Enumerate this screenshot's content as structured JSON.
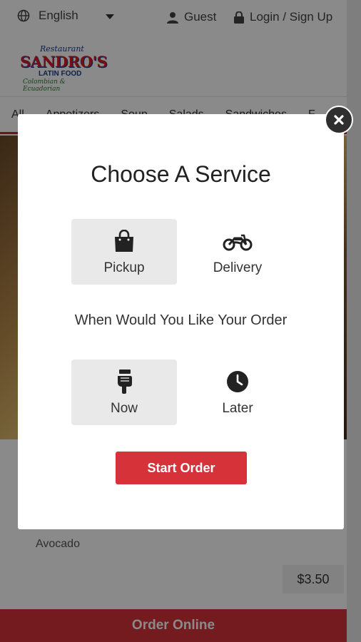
{
  "topbar": {
    "language": "English",
    "guest": "Guest",
    "login": "Login / Sign Up"
  },
  "logo": {
    "script": "Restaurant",
    "main": "SANDRO'S",
    "sub": "LATIN FOOD",
    "tag": "Colombian & Ecuadorian"
  },
  "categories": [
    "All",
    "Appetizers",
    "Soup",
    "Salads",
    "Sandwiches",
    "F"
  ],
  "menu_item": {
    "description": "Avocado",
    "price": "$3.50"
  },
  "order_bar": {
    "label": "Order Online"
  },
  "modal": {
    "title": "Choose A Service",
    "service_options": [
      {
        "label": "Pickup",
        "icon": "shopping-bag-icon",
        "selected": true
      },
      {
        "label": "Delivery",
        "icon": "motorcycle-icon",
        "selected": false
      }
    ],
    "when_prompt": "When Would You Like Your Order",
    "time_options": [
      {
        "label": "Now",
        "icon": "pointing-hand-icon",
        "selected": true
      },
      {
        "label": "Later",
        "icon": "clock-icon",
        "selected": false
      }
    ],
    "start_button": "Start Order"
  },
  "colors": {
    "accent_red": "#d6323a",
    "selected_bg": "#e9e9e9",
    "overlay": "rgba(0,0,0,0.46)"
  }
}
